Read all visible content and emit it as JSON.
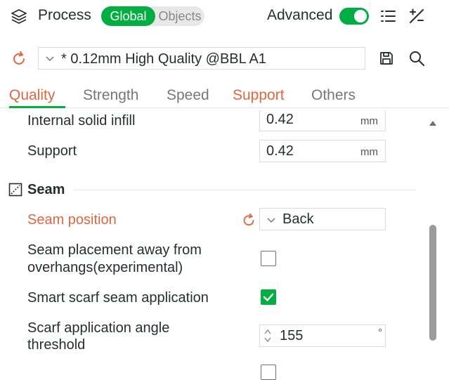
{
  "header": {
    "title": "Process",
    "mode_global": "Global",
    "mode_objects": "Objects",
    "advanced_label": "Advanced",
    "advanced_on": true
  },
  "preset": {
    "name": "* 0.12mm High Quality @BBL A1"
  },
  "tabs": [
    {
      "label": "Quality",
      "active": true,
      "modified": true
    },
    {
      "label": "Strength",
      "active": false,
      "modified": false
    },
    {
      "label": "Speed",
      "active": false,
      "modified": false
    },
    {
      "label": "Support",
      "active": false,
      "modified": true
    },
    {
      "label": "Others",
      "active": false,
      "modified": false
    }
  ],
  "line_width": {
    "internal_solid_infill": {
      "label": "Internal solid infill",
      "value": "0.42",
      "unit": "mm"
    },
    "support": {
      "label": "Support",
      "value": "0.42",
      "unit": "mm"
    }
  },
  "seam": {
    "title": "Seam",
    "position": {
      "label": "Seam position",
      "value": "Back"
    },
    "away_from_overhangs": {
      "label_line1": "Seam placement away from",
      "label_line2": "overhangs(experimental)",
      "checked": false
    },
    "smart_scarf": {
      "label": "Smart scarf seam application",
      "checked": true
    },
    "scarf_angle": {
      "label_line1": "Scarf application angle",
      "label_line2": "threshold",
      "value": "155",
      "unit": "°"
    }
  },
  "colors": {
    "accent_green": "#00ae42",
    "modified_orange": "#e0663f",
    "text": "#262e30"
  }
}
